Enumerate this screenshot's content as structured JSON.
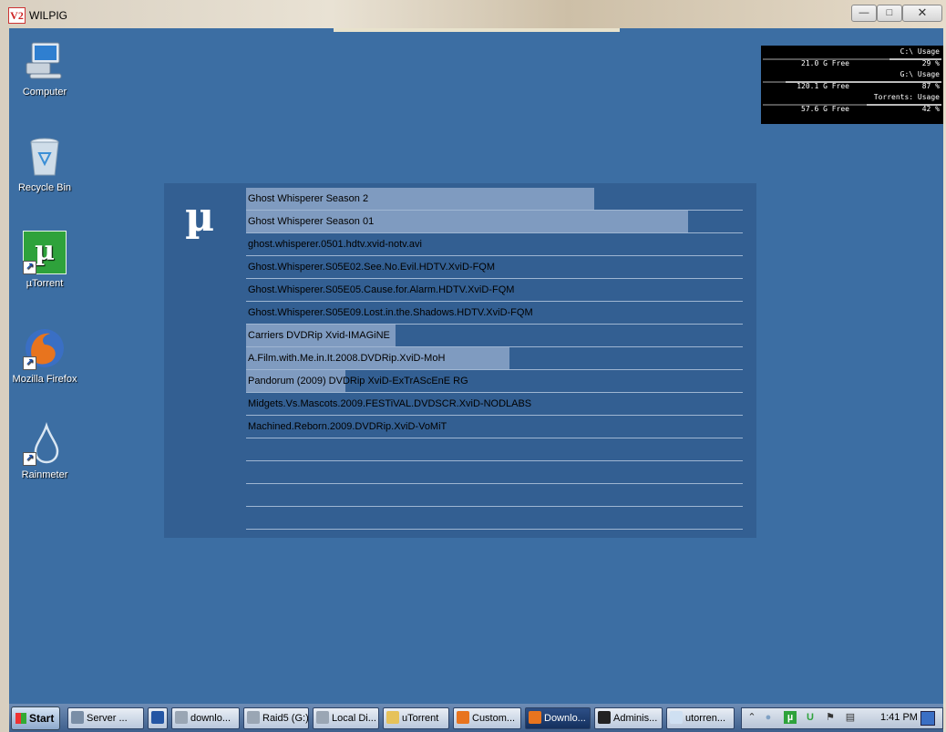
{
  "window": {
    "title": "WILPIG",
    "icon_label": "V2"
  },
  "desktop_icons": [
    {
      "label": "Computer",
      "icon": "computer-icon"
    },
    {
      "label": "Recycle Bin",
      "icon": "recycle-bin-icon"
    },
    {
      "label": "µTorrent",
      "icon": "utorrent-icon"
    },
    {
      "label": "Mozilla Firefox",
      "icon": "firefox-icon"
    },
    {
      "label": "Rainmeter",
      "icon": "rainmeter-icon"
    }
  ],
  "disk_usage": [
    {
      "header": "C:\\ Usage",
      "free": "21.0 G Free",
      "pct": "29 %",
      "fraction": 0.29
    },
    {
      "header": "G:\\ Usage",
      "free": "120.1 G Free",
      "pct": "87 %",
      "fraction": 0.87
    },
    {
      "header": "Torrents: Usage",
      "free": "57.6 G Free",
      "pct": "42 %",
      "fraction": 0.42
    }
  ],
  "torrent_panel": {
    "logo": "µ",
    "items": [
      {
        "name": "Ghost Whisperer Season 2",
        "progress": 0.7
      },
      {
        "name": "Ghost Whisperer Season 01",
        "progress": 0.89
      },
      {
        "name": "ghost.whisperer.0501.hdtv.xvid-notv.avi",
        "progress": 0
      },
      {
        "name": "Ghost.Whisperer.S05E02.See.No.Evil.HDTV.XviD-FQM",
        "progress": 0
      },
      {
        "name": "Ghost.Whisperer.S05E05.Cause.for.Alarm.HDTV.XviD-FQM",
        "progress": 0
      },
      {
        "name": "Ghost.Whisperer.S05E09.Lost.in.the.Shadows.HDTV.XviD-FQM",
        "progress": 0
      },
      {
        "name": "Carriers DVDRip Xvid-IMAGiNE",
        "progress": 0.3
      },
      {
        "name": "A.Film.with.Me.in.It.2008.DVDRip.XviD-MoH",
        "progress": 0.53
      },
      {
        "name": "Pandorum (2009) DVDRip XviD-ExTrAScEnE RG",
        "progress": 0.2
      },
      {
        "name": "Midgets.Vs.Mascots.2009.FESTiVAL.DVDSCR.XviD-NODLABS",
        "progress": 0
      },
      {
        "name": "Machined.Reborn.2009.DVDRip.XviD-VoMiT",
        "progress": 0
      },
      {
        "name": "",
        "progress": 0
      },
      {
        "name": "",
        "progress": 0
      },
      {
        "name": "",
        "progress": 0
      },
      {
        "name": "",
        "progress": 0
      }
    ]
  },
  "taskbar": {
    "start_label": "Start",
    "buttons": [
      {
        "label": "Server ...",
        "icon": "server-manager-icon",
        "active": false
      },
      {
        "label": "",
        "icon": "powershell-icon",
        "active": false
      },
      {
        "label": "downlo...",
        "icon": "drive-icon",
        "active": false
      },
      {
        "label": "Raid5 (G:)",
        "icon": "drive-icon",
        "active": false
      },
      {
        "label": "Local Di...",
        "icon": "drive-icon",
        "active": false
      },
      {
        "label": "uTorrent",
        "icon": "folder-icon",
        "active": false
      },
      {
        "label": "Custom...",
        "icon": "firefox-icon",
        "active": false
      },
      {
        "label": "Downlo...",
        "icon": "firefox-icon",
        "active": true
      },
      {
        "label": "Adminis...",
        "icon": "cmd-icon",
        "active": false
      },
      {
        "label": "utorren...",
        "icon": "notepad-icon",
        "active": false
      }
    ],
    "clock": "1:41 PM"
  },
  "colors": {
    "desktop": "#3c6ea3",
    "panel": "#335f92",
    "progress": "#7f9bc0"
  }
}
